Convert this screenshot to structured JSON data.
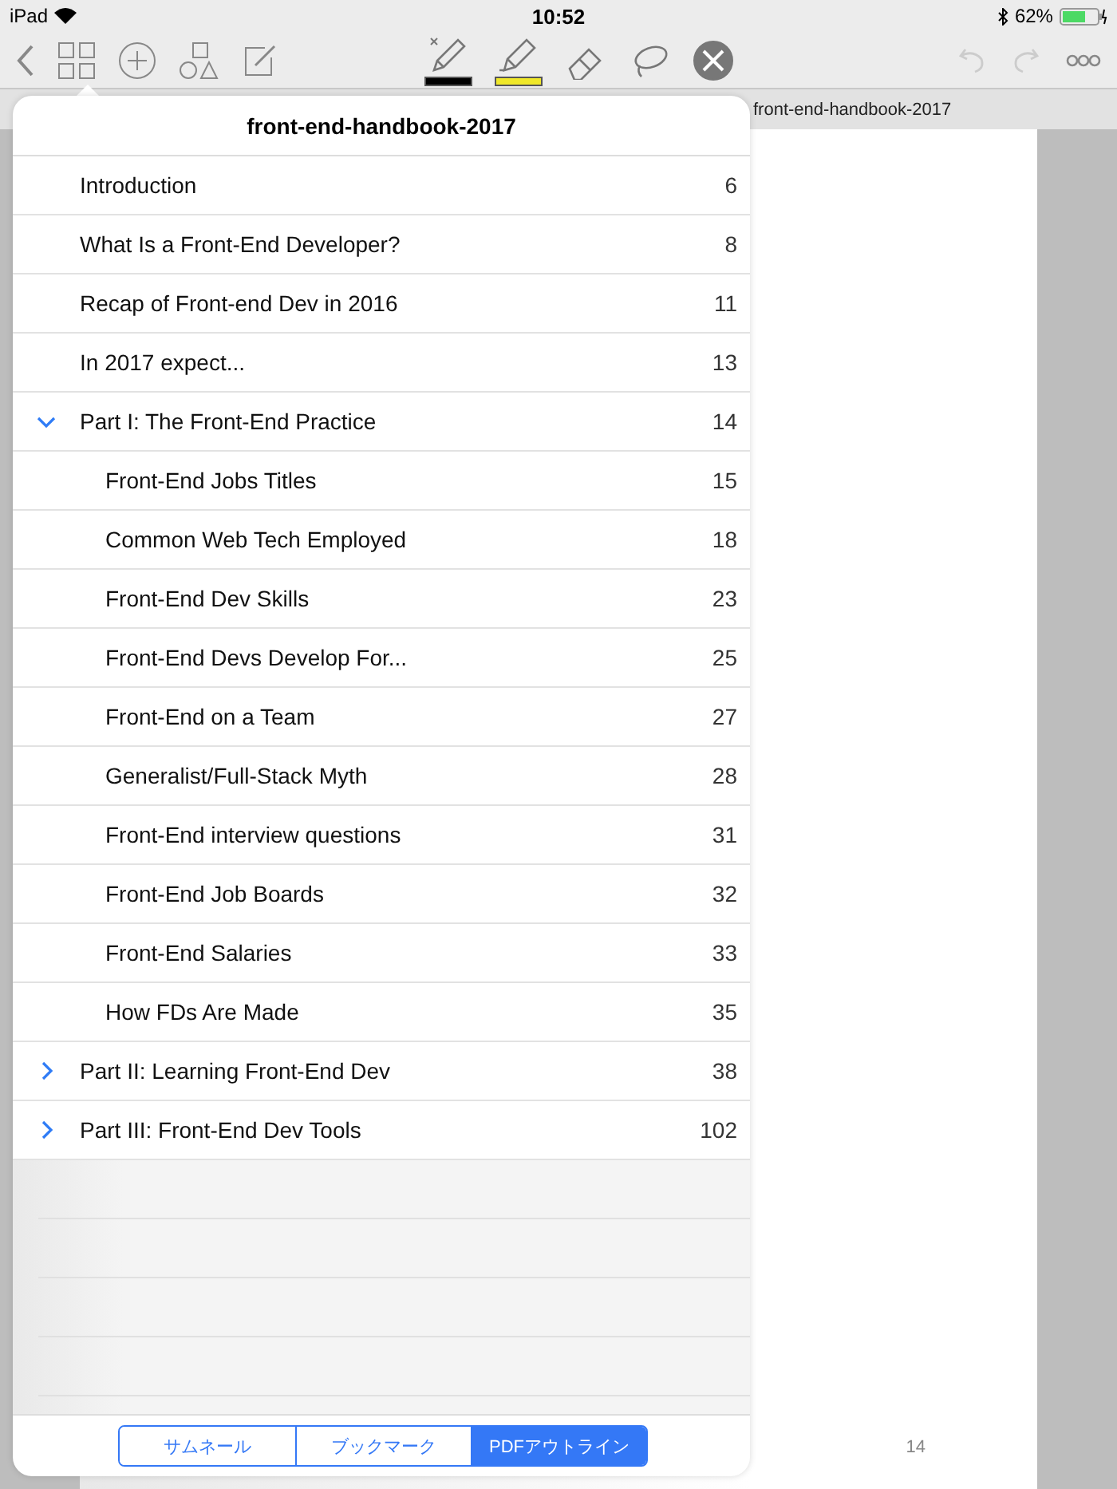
{
  "status_bar": {
    "device": "iPad",
    "time": "10:52",
    "battery": "62%"
  },
  "toolbar": {
    "tools": [
      {
        "kind": "pen",
        "color": "#000000"
      },
      {
        "kind": "highlighter",
        "color": "#f0e82a"
      },
      {
        "kind": "eraser"
      },
      {
        "kind": "lasso"
      },
      {
        "kind": "stop"
      }
    ],
    "undo_disabled": true,
    "redo_disabled": true
  },
  "document": {
    "tab_title": "front-end-handbook-2017",
    "page_number": "14"
  },
  "outline": {
    "title": "front-end-handbook-2017",
    "items": [
      {
        "title": "Introduction",
        "page": "6"
      },
      {
        "title": "What Is a Front-End Developer?",
        "page": "8"
      },
      {
        "title": "Recap of Front-end Dev in 2016",
        "page": "11"
      },
      {
        "title": "In 2017 expect...",
        "page": "13"
      },
      {
        "title": "Part I: The Front-End Practice",
        "page": "14",
        "expanded": true,
        "children": [
          {
            "title": "Front-End Jobs Titles",
            "page": "15"
          },
          {
            "title": "Common Web Tech Employed",
            "page": "18"
          },
          {
            "title": "Front-End Dev Skills",
            "page": "23"
          },
          {
            "title": "Front-End Devs Develop For...",
            "page": "25"
          },
          {
            "title": "Front-End on a Team",
            "page": "27"
          },
          {
            "title": "Generalist/Full-Stack Myth",
            "page": "28"
          },
          {
            "title": "Front-End interview questions",
            "page": "31"
          },
          {
            "title": "Front-End Job Boards",
            "page": "32"
          },
          {
            "title": "Front-End Salaries",
            "page": "33"
          },
          {
            "title": "How FDs Are Made",
            "page": "35"
          }
        ]
      },
      {
        "title": "Part II: Learning Front-End Dev",
        "page": "38",
        "expanded": false
      },
      {
        "title": "Part III: Front-End Dev Tools",
        "page": "102",
        "expanded": false
      }
    ]
  },
  "segments": [
    {
      "label": "サムネール",
      "selected": false
    },
    {
      "label": "ブックマーク",
      "selected": false
    },
    {
      "label": "PDFアウトライン",
      "selected": true
    }
  ]
}
